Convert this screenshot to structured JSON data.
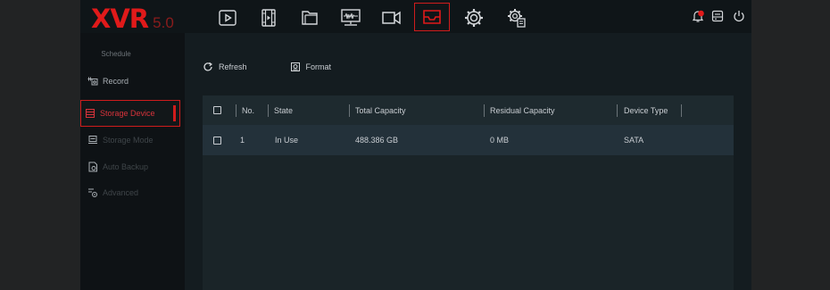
{
  "app": {
    "brand": "XVR",
    "version": "5.0"
  },
  "topnav": [
    {
      "icon": "playback-icon",
      "active": false
    },
    {
      "icon": "film-icon",
      "active": false
    },
    {
      "icon": "folder-icon",
      "active": false
    },
    {
      "icon": "monitor-icon",
      "active": false
    },
    {
      "icon": "camera-icon",
      "active": false
    },
    {
      "icon": "storage-icon",
      "active": true
    },
    {
      "icon": "settings-icon",
      "active": false
    },
    {
      "icon": "advanced-settings-icon",
      "active": false
    }
  ],
  "status": {
    "icons": [
      "alarm-bell-icon",
      "hdd-status-icon",
      "power-icon"
    ],
    "alarm_color": "#e01a1a"
  },
  "sidebar": {
    "header": "Schedule",
    "items": [
      {
        "label": "Record",
        "icon": "record-icon",
        "state": "normal"
      },
      {
        "label": "Storage Device",
        "icon": "storage-device-icon",
        "state": "active"
      },
      {
        "label": "Storage Mode",
        "icon": "storage-mode-icon",
        "state": "dim"
      },
      {
        "label": "Auto Backup",
        "icon": "auto-backup-icon",
        "state": "dim"
      },
      {
        "label": "Advanced",
        "icon": "advanced-icon",
        "state": "dim"
      }
    ]
  },
  "toolbar": {
    "refresh_label": "Refresh",
    "format_label": "Format"
  },
  "table": {
    "headers": {
      "no": "No.",
      "state": "State",
      "total": "Total Capacity",
      "residual": "Residual Capacity",
      "device_type": "Device Type"
    },
    "rows": [
      {
        "no": "1",
        "state": "In Use",
        "total": "488.386 GB",
        "residual": "0 MB",
        "device_type": "SATA"
      }
    ]
  },
  "colors": {
    "accent": "#d01c1c",
    "background": "#141c20"
  }
}
